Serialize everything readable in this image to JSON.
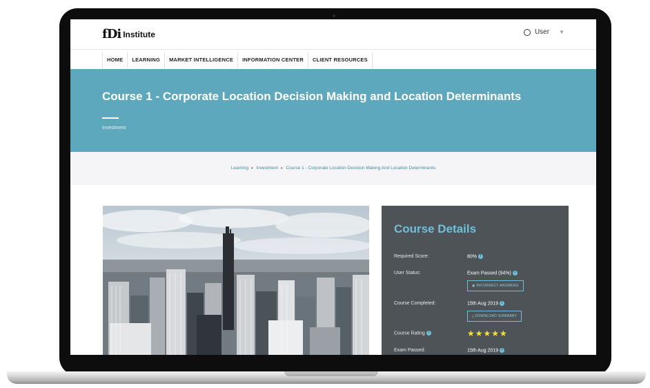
{
  "header": {
    "logo_mark": "fDi",
    "logo_text": "Institute",
    "user_label": "User"
  },
  "nav": {
    "items": [
      "HOME",
      "LEARNING",
      "MARKET INTELLIGENCE",
      "INFORMATION CENTER",
      "CLIENT RESOURCES"
    ]
  },
  "hero": {
    "title": "Course 1 - Corporate Location Decision Making and Location Determinants",
    "subtitle": "Investment"
  },
  "breadcrumb": [
    "Learning",
    "Investment",
    "Course 1 - Corporate Location Decision Making And Location Determinants"
  ],
  "details": {
    "title": "Course Details",
    "required_score_label": "Required Score:",
    "required_score_value": "80%",
    "user_status_label": "User Status:",
    "user_status_value": "Exam Passed (94%)",
    "incorrect_button": "INCORRECT ANSWERS",
    "completed_label": "Course Completed:",
    "completed_value": "15th Aug 2019",
    "download_button": "DOWNLOAD SUMMARY",
    "rating_label": "Course Rating",
    "rating_stars": 5,
    "stars_text": "★★★★★",
    "exam_passed_label": "Exam Passed:",
    "exam_passed_value": "15th Aug 2019"
  },
  "colors": {
    "hero": "#5ea8be",
    "accent": "#6fc0d8",
    "panel": "#4d5357",
    "star": "#f4e13a"
  }
}
